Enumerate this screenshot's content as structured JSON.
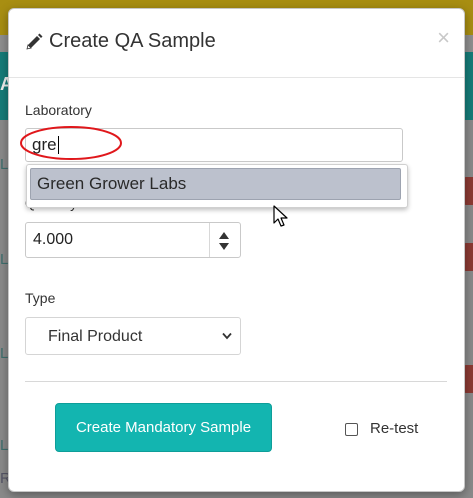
{
  "background": {
    "glyphs": [
      "A",
      "L",
      "L",
      "L",
      "L",
      "R"
    ]
  },
  "modal": {
    "title": "Create QA Sample",
    "close_label": "×"
  },
  "form": {
    "laboratory": {
      "label": "Laboratory",
      "value": "gre",
      "suggestions": [
        "Green Grower Labs"
      ]
    },
    "quantity": {
      "label": "Quantity",
      "value": "4.000"
    },
    "type": {
      "label": "Type",
      "value": "Final Product"
    }
  },
  "actions": {
    "create_label": "Create Mandatory Sample",
    "retest_label": "Re-test"
  },
  "colors": {
    "accent": "#13b5b0",
    "annotation": "#e0171b",
    "suggestion_highlight": "#bcc1cd"
  },
  "icons": {
    "title": "pencil-icon",
    "close": "close-icon",
    "spinner": "spinner-arrows-icon",
    "select": "chevron-down-icon",
    "cursor": "mouse-pointer-icon"
  }
}
